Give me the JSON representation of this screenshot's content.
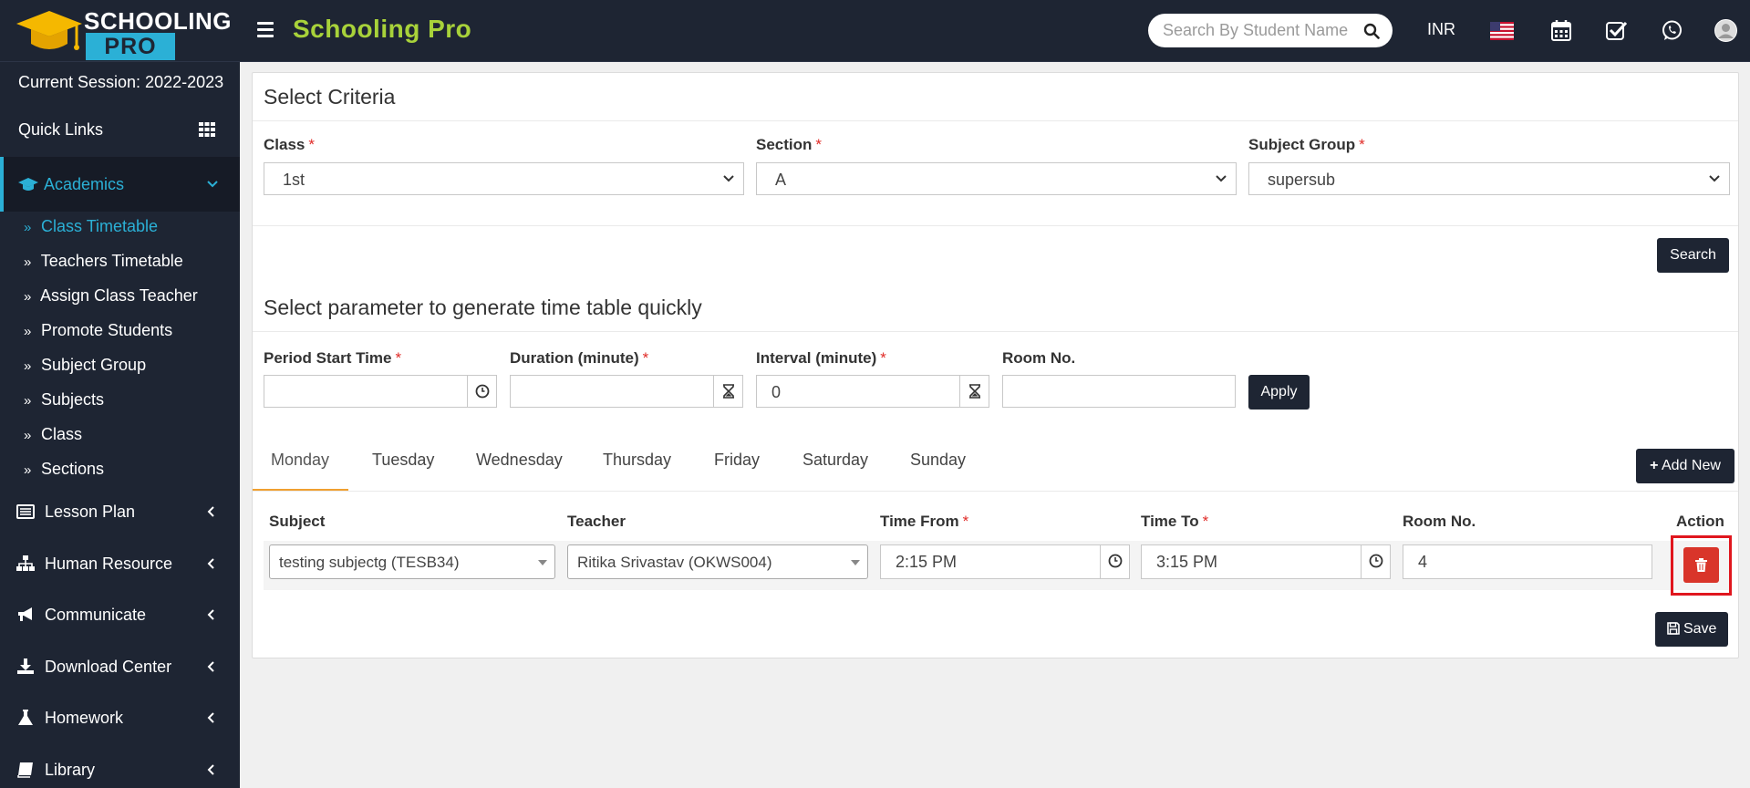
{
  "header": {
    "logo_word1": "SCHOOLING",
    "logo_word2": "PRO",
    "app_title": "Schooling Pro",
    "search_placeholder": "Search By Student Name",
    "currency": "INR",
    "icons": [
      "us-flag-icon",
      "calendar-icon",
      "task-check-icon",
      "whatsapp-icon",
      "user-avatar-icon"
    ]
  },
  "sidebar": {
    "session": "Current Session: 2022-2023",
    "quick_links": "Quick Links",
    "active_section": "Academics",
    "sub_items": [
      {
        "label": "Class Timetable",
        "active": true
      },
      {
        "label": "Teachers Timetable"
      },
      {
        "label": "Assign Class Teacher"
      },
      {
        "label": "Promote Students"
      },
      {
        "label": "Subject Group"
      },
      {
        "label": "Subjects"
      },
      {
        "label": "Class"
      },
      {
        "label": "Sections"
      }
    ],
    "sections": [
      "Lesson Plan",
      "Human Resource",
      "Communicate",
      "Download Center",
      "Homework",
      "Library"
    ]
  },
  "criteria": {
    "title": "Select Criteria",
    "class_label": "Class",
    "class_value": "1st",
    "section_label": "Section",
    "section_value": "A",
    "subject_group_label": "Subject Group",
    "subject_group_value": "supersub",
    "search_button": "Search"
  },
  "params": {
    "title": "Select parameter to generate time table quickly",
    "start_label": "Period Start Time",
    "start_value": "",
    "duration_label": "Duration (minute)",
    "duration_value": "",
    "interval_label": "Interval (minute)",
    "interval_value": "0",
    "room_label": "Room No.",
    "room_value": "",
    "apply_button": "Apply"
  },
  "tabs": [
    "Monday",
    "Tuesday",
    "Wednesday",
    "Thursday",
    "Friday",
    "Saturday",
    "Sunday"
  ],
  "add_new_button": "Add New",
  "table": {
    "headers": {
      "subject": "Subject",
      "teacher": "Teacher",
      "time_from": "Time From",
      "time_to": "Time To",
      "room": "Room No.",
      "action": "Action"
    },
    "row": {
      "subject": "testing subjectg (TESB34)",
      "teacher": "Ritika Srivastav (OKWS004)",
      "time_from": "2:15 PM",
      "time_to": "3:15 PM",
      "room": "4"
    }
  },
  "save_button": "Save",
  "colors": {
    "accent": "#2bb0d6",
    "brand_title": "#a8d23a",
    "dark": "#1e2533",
    "danger": "#d9352a",
    "tab_underline": "#f0a030"
  }
}
